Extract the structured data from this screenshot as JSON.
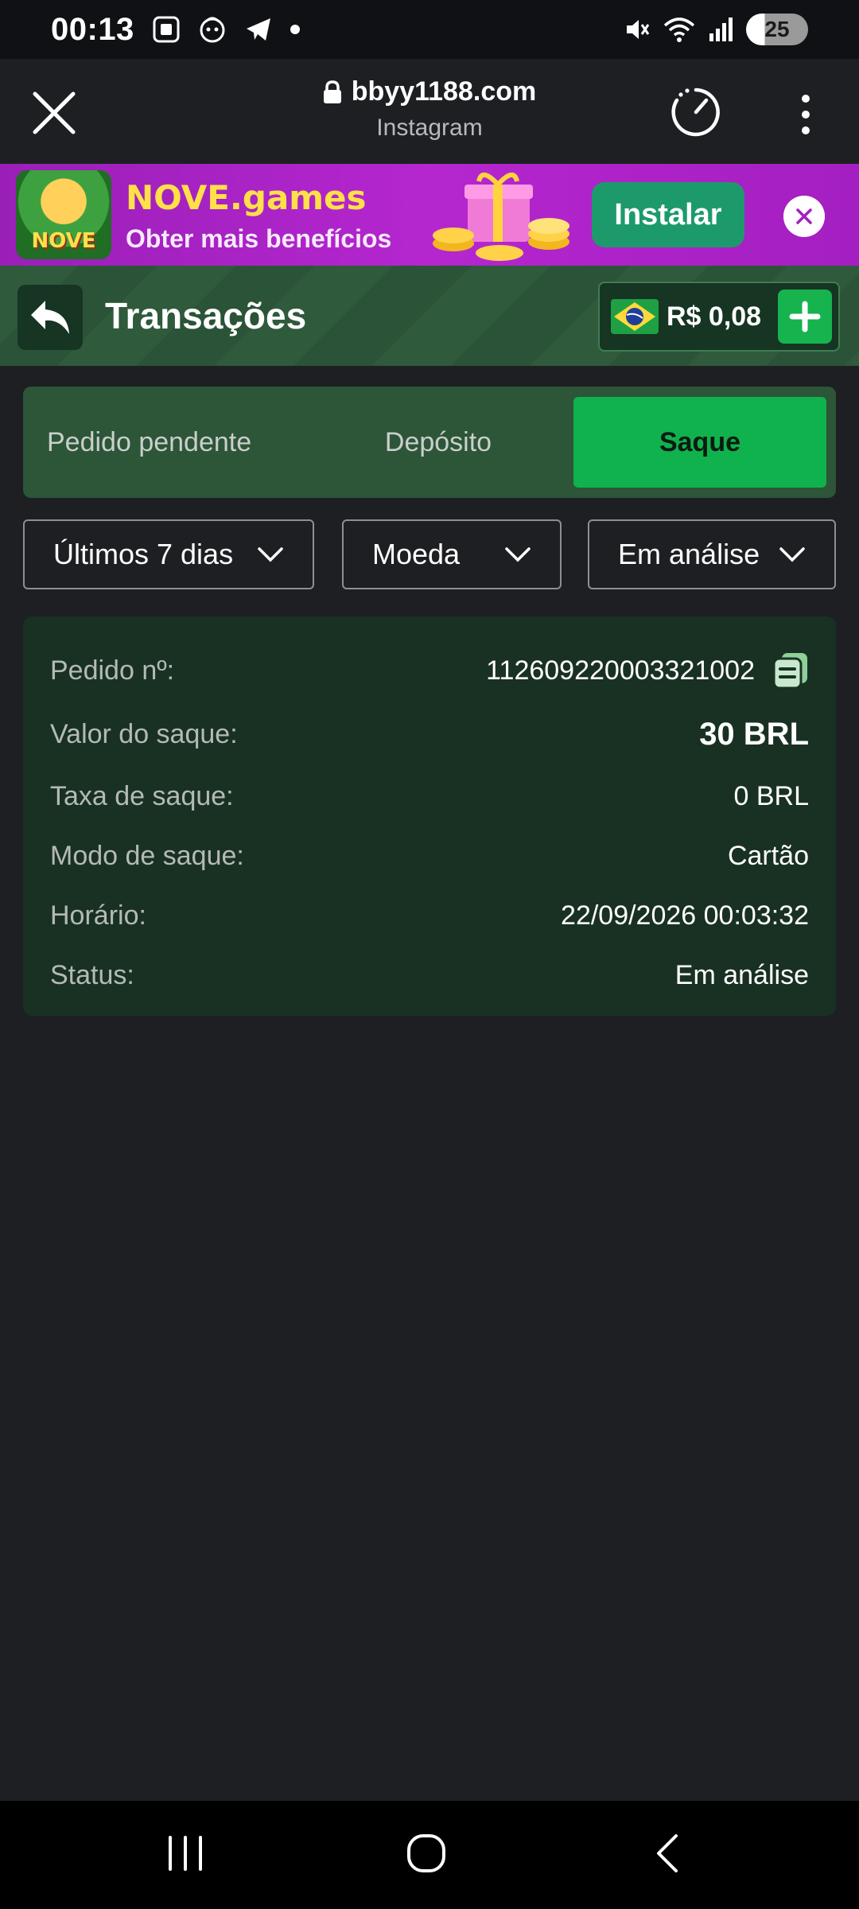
{
  "status_bar": {
    "time": "00:13",
    "battery": "25",
    "icons_left": [
      "screenshot-icon",
      "face-icon",
      "telegram-icon",
      "dot-icon"
    ],
    "icons_right": [
      "mute-icon",
      "wifi-icon",
      "signal-icon",
      "battery-icon"
    ]
  },
  "browser": {
    "url": "bbyy1188.com",
    "app": "Instagram"
  },
  "ad": {
    "logo_text": "NOVE",
    "title": "NOVE.games",
    "subtitle": "Obter mais benefícios",
    "install_label": "Instalar"
  },
  "header": {
    "title": "Transações",
    "balance": "R$ 0,08"
  },
  "tabs": [
    {
      "label": "Pedido pendente",
      "active": false
    },
    {
      "label": "Depósito",
      "active": false
    },
    {
      "label": "Saque",
      "active": true
    }
  ],
  "filters": {
    "period": "Últimos 7 dias",
    "currency": "Moeda",
    "status": "Em análise"
  },
  "transaction": {
    "order_label": "Pedido nº:",
    "order_value": "112609220003321002",
    "amount_label": "Valor do saque:",
    "amount_value": "30 BRL",
    "fee_label": "Taxa de saque:",
    "fee_value": "0 BRL",
    "mode_label": "Modo de saque:",
    "mode_value": "Cartão",
    "time_label": "Horário:",
    "time_value": "22/09/2026 00:03:32",
    "status_label": "Status:",
    "status_value": "Em análise"
  },
  "colors": {
    "accent_green": "#0fb24d",
    "header_green": "#2f5a3c",
    "card_bg": "#193123",
    "page_bg": "#1e1f23",
    "ad_purple": "#b526cf",
    "ad_yellow": "#ffe048"
  }
}
